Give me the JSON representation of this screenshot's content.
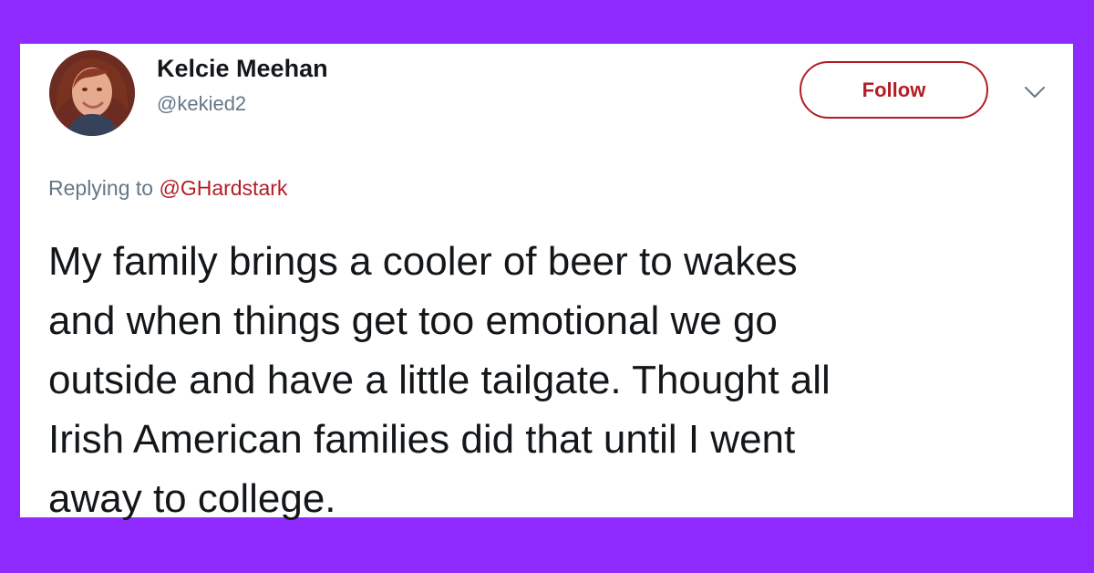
{
  "background": {
    "accent_color": "#8f2bff"
  },
  "tweet": {
    "avatar": {
      "icon": "profile-avatar"
    },
    "user": {
      "display_name": "Kelcie Meehan",
      "handle": "@kekied2"
    },
    "follow_button": {
      "label": "Follow",
      "color": "#b31d25"
    },
    "menu": {
      "icon": "chevron-down-icon"
    },
    "reply": {
      "prefix": "Replying to",
      "mention": "@GHardstark",
      "mention_color": "#b31d25"
    },
    "body": {
      "text": "My family brings a cooler of beer to wakes\nand when things get too emotional we go\noutside and have a little tailgate. Thought all\nIrish American families did that until I went\naway to college."
    }
  }
}
